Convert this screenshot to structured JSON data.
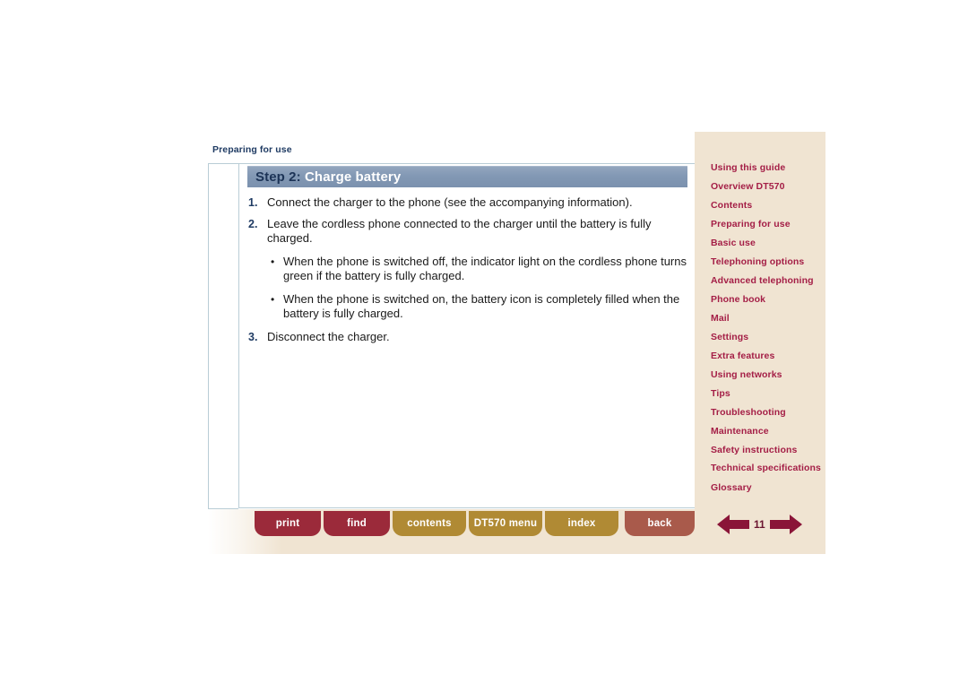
{
  "breadcrumb": "Preparing for use",
  "step_header": {
    "step_label": "Step 2:",
    "title": "Charge battery"
  },
  "content": {
    "items": [
      {
        "marker": "1.",
        "text": "Connect the charger to the phone (see the accompanying information)."
      },
      {
        "marker": "2.",
        "text": "Leave the cordless phone connected to the charger until the battery is fully charged."
      },
      {
        "marker": "3.",
        "text": "Disconnect the charger."
      }
    ],
    "bullets": [
      {
        "marker": "•",
        "text": "When the phone is switched off, the indicator light on the cordless phone turns green if the battery is fully charged."
      },
      {
        "marker": "•",
        "text": "When the phone is switched on, the battery icon is completely filled when the battery is fully charged."
      }
    ]
  },
  "sidebar": {
    "items": [
      {
        "label": "Using this guide"
      },
      {
        "label": "Overview DT570"
      },
      {
        "label": "Contents"
      },
      {
        "label": "Preparing for use"
      },
      {
        "label": "Basic use"
      },
      {
        "label": "Telephoning options"
      },
      {
        "label": "Advanced telephoning"
      },
      {
        "label": "Phone book"
      },
      {
        "label": "Mail"
      },
      {
        "label": "Settings"
      },
      {
        "label": "Extra features"
      },
      {
        "label": "Using networks"
      },
      {
        "label": "Tips"
      },
      {
        "label": "Troubleshooting"
      },
      {
        "label": "Maintenance"
      },
      {
        "label": "Safety instructions"
      },
      {
        "label": "Technical specifications"
      },
      {
        "label": "Glossary"
      }
    ]
  },
  "toolbar": {
    "buttons": [
      {
        "label": "print",
        "style": "red",
        "width": 74
      },
      {
        "label": "find",
        "style": "red",
        "width": 74
      },
      {
        "label": "contents",
        "style": "gold",
        "width": 82
      },
      {
        "label": "DT570 menu",
        "style": "gold",
        "width": 82
      },
      {
        "label": "index",
        "style": "gold",
        "width": 82
      },
      {
        "label": "back",
        "style": "brown",
        "width": 78
      }
    ],
    "page_number": "11",
    "prev_icon": "left-arrow-icon",
    "next_icon": "right-arrow-icon"
  },
  "colors": {
    "sidebar_bg": "#f0e4d2",
    "sidebar_link": "#a41e46",
    "header_bar": "#7b91ae",
    "header_step": "#1c3356",
    "breadcrumb": "#1f3b63",
    "btn_red": "#9b2a3a",
    "btn_gold": "#b08a34",
    "btn_brown": "#a95a4b",
    "arrow": "#8a1538",
    "sheet_border": "#b9cdd6"
  }
}
